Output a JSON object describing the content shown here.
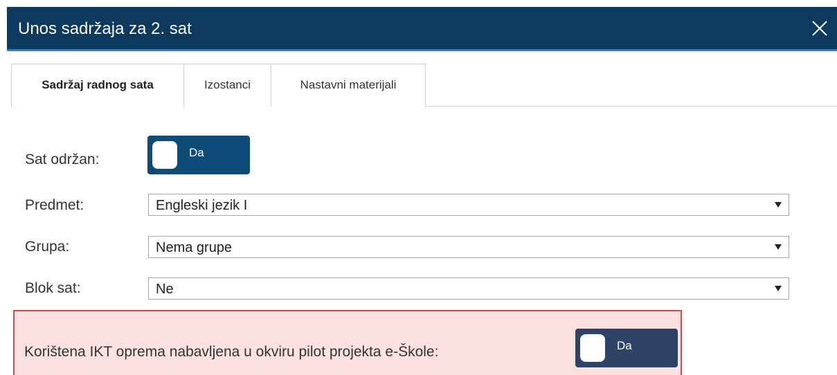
{
  "modal": {
    "title": "Unos sadržaja za 2. sat",
    "close_icon": "close-icon"
  },
  "tabs": [
    {
      "label": "Sadržaj radnog sata",
      "active": true
    },
    {
      "label": "Izostanci",
      "active": false
    },
    {
      "label": "Nastavni materijali",
      "active": false
    }
  ],
  "form": {
    "sat_odrzan": {
      "label": "Sat održan:",
      "toggle_text": "Da",
      "value": true
    },
    "predmet": {
      "label": "Predmet:",
      "value": "Engleski jezik I"
    },
    "grupa": {
      "label": "Grupa:",
      "value": "Nema grupe"
    },
    "blok_sat": {
      "label": "Blok sat:",
      "value": "Ne"
    },
    "ikt": {
      "label": "Korištena IKT oprema nabavljena u okviru pilot projekta e-Škole:",
      "toggle_text": "Da",
      "value": true
    }
  },
  "colors": {
    "header_bg": "#0f3a5f",
    "toggle_primary": "#0f4b79",
    "toggle_secondary": "#2e4466",
    "highlight_bg": "#fde0e0",
    "highlight_border": "#e04545"
  }
}
